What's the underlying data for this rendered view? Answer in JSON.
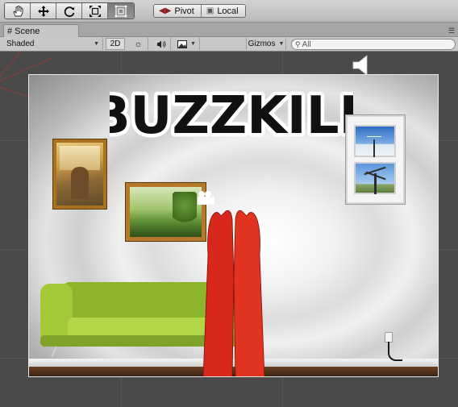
{
  "toolbar": {
    "tools": [
      {
        "name": "hand-tool",
        "icon": "hand-icon"
      },
      {
        "name": "move-tool",
        "icon": "move-arrows-icon"
      },
      {
        "name": "rotate-tool",
        "icon": "rotate-icon"
      },
      {
        "name": "scale-tool",
        "icon": "scale-icon"
      },
      {
        "name": "rect-tool",
        "icon": "rect-transform-icon"
      }
    ],
    "active_tool": "rect-tool",
    "pivot_label": "Pivot",
    "local_label": "Local"
  },
  "tab": {
    "icon": "grid-hash-icon",
    "label": "Scene"
  },
  "scene_toolbar": {
    "shading_mode": "Shaded",
    "mode_2d_label": "2D",
    "lighting_icon": "sun-icon",
    "audio_icon": "speaker-icon",
    "effects_icon": "image-icon",
    "gizmos_label": "Gizmos",
    "search_placeholder": "All"
  },
  "scene": {
    "game_title": "BUZZKILL"
  },
  "colors": {
    "toolbar_bg": "#c8c8c8",
    "viewport_bg": "#4a4a4a",
    "couch_green": "#8db52b",
    "arms_red": "#d8281c",
    "frame_gold": "#a8721f"
  }
}
